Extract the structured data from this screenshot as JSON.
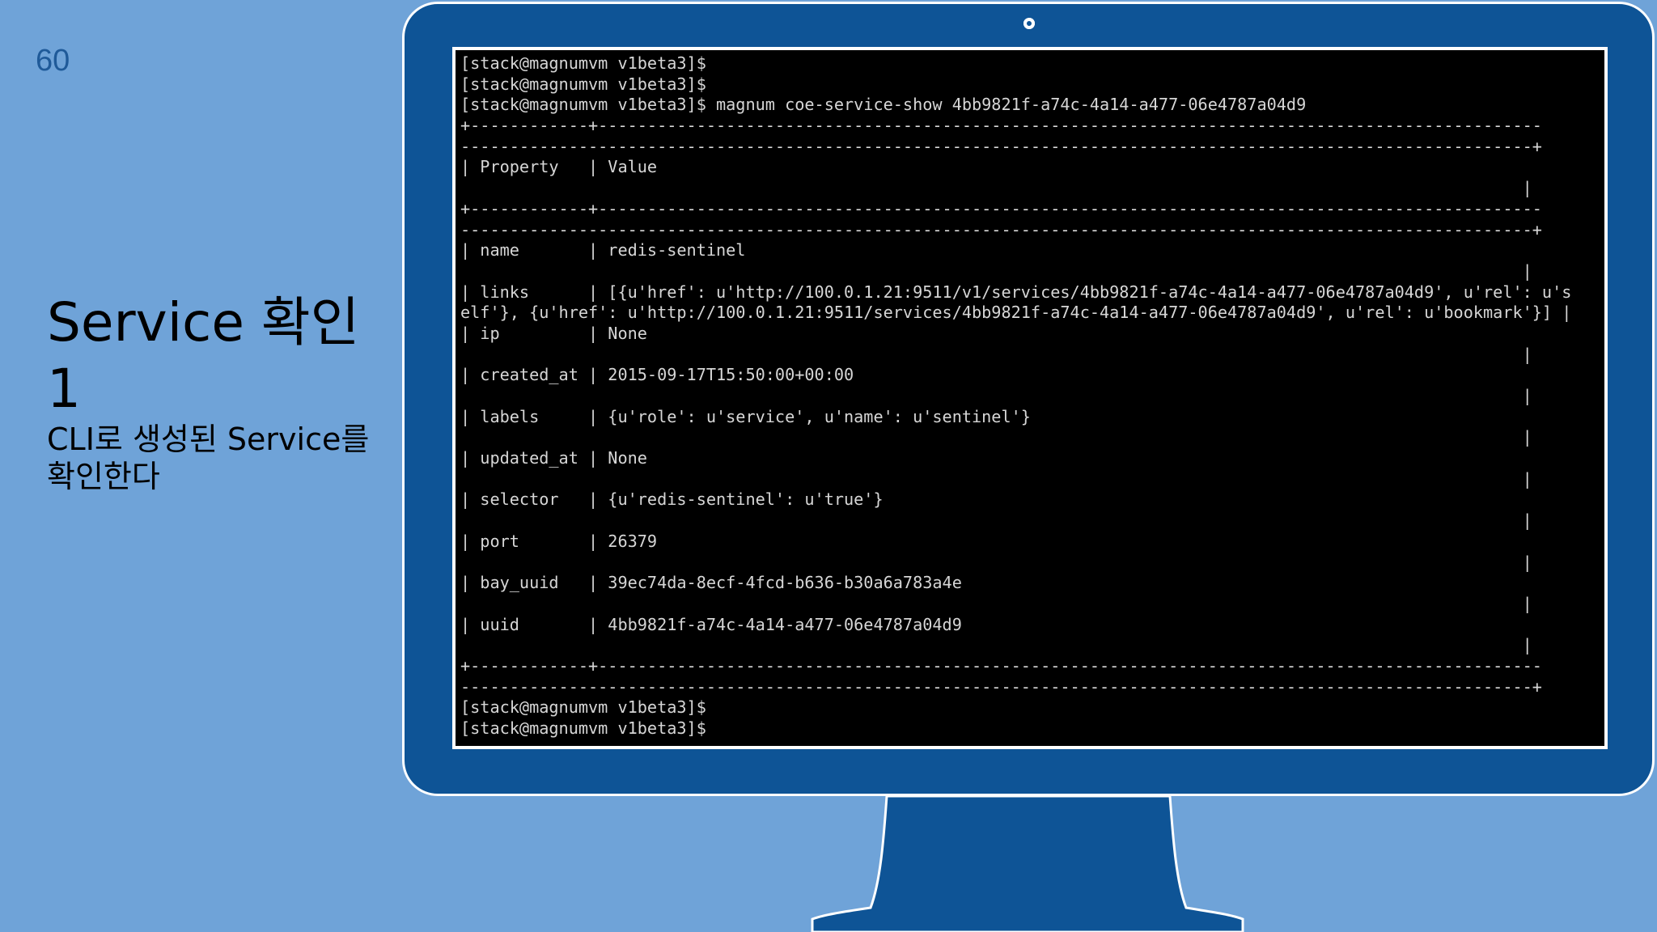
{
  "slide": {
    "page_number": "60",
    "title_line1": "Service 확인",
    "title_line2": "1",
    "subtitle_line1": "CLI로 생성된 Service를",
    "subtitle_line2": "확인한다"
  },
  "terminal": {
    "lines": [
      "[stack@magnumvm v1beta3]$",
      "[stack@magnumvm v1beta3]$",
      "[stack@magnumvm v1beta3]$ magnum coe-service-show 4bb9821f-a74c-4a14-a477-06e4787a04d9",
      "+------------+------------------------------------------------------------------------------------------------",
      "-------------------------------------------------------------------------------------------------------------+",
      "| Property   | Value",
      "                                                                                                            |",
      "+------------+------------------------------------------------------------------------------------------------",
      "-------------------------------------------------------------------------------------------------------------+",
      "| name       | redis-sentinel",
      "                                                                                                            |",
      "| links      | [{u'href': u'http://100.0.1.21:9511/v1/services/4bb9821f-a74c-4a14-a477-06e4787a04d9', u'rel': u's",
      "elf'}, {u'href': u'http://100.0.1.21:9511/services/4bb9821f-a74c-4a14-a477-06e4787a04d9', u'rel': u'bookmark'}] |",
      "| ip         | None",
      "                                                                                                            |",
      "| created_at | 2015-09-17T15:50:00+00:00",
      "                                                                                                            |",
      "| labels     | {u'role': u'service', u'name': u'sentinel'}",
      "                                                                                                            |",
      "| updated_at | None",
      "                                                                                                            |",
      "| selector   | {u'redis-sentinel': u'true'}",
      "                                                                                                            |",
      "| port       | 26379",
      "                                                                                                            |",
      "| bay_uuid   | 39ec74da-8ecf-4fcd-b636-b30a6a783a4e",
      "                                                                                                            |",
      "| uuid       | 4bb9821f-a74c-4a14-a477-06e4787a04d9",
      "                                                                                                            |",
      "+------------+------------------------------------------------------------------------------------------------",
      "-------------------------------------------------------------------------------------------------------------+",
      "[stack@magnumvm v1beta3]$",
      "[stack@magnumvm v1beta3]$"
    ]
  }
}
